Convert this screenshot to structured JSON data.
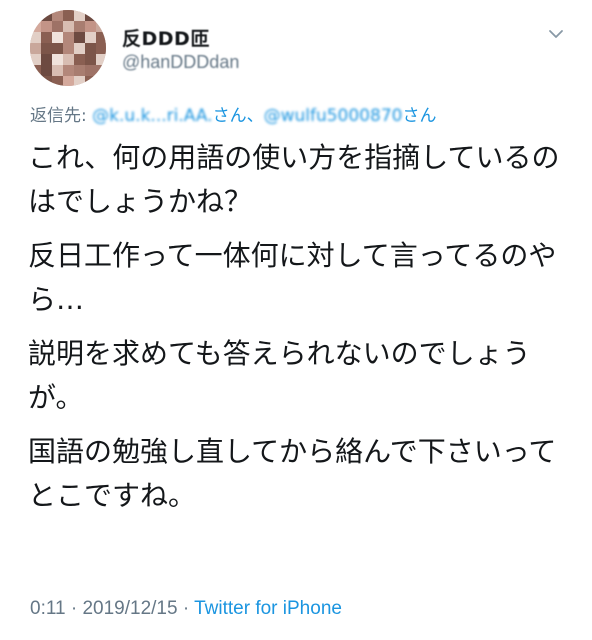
{
  "author": {
    "display_name": "反DDD匝",
    "handle": "@hanDDDdan",
    "avatar_icon": "pixelated-avatar-icon"
  },
  "menu_icon": "chevron-down-icon",
  "reply": {
    "prefix": "返信先: ",
    "mention_1": "@k.u.k...ri.AA.",
    "suffix_1": "さん、",
    "mention_2": "@wulfu5000870",
    "suffix_2": "さん"
  },
  "tweet": {
    "paragraphs": [
      "これ、何の用語の使い方を指摘しているのはでしょうかね？",
      "反日工作って一体何に対して言ってるのやら…",
      "説明を求めても答えられないのでしょうが。",
      "国語の勉強し直してから絡んで下さいってとこですね。"
    ]
  },
  "meta": {
    "time": "0:11",
    "separator": " · ",
    "date": "2019/12/15",
    "source_prefix": " · ",
    "source": "Twitter for iPhone"
  },
  "colors": {
    "link": "#1b95e0",
    "secondary": "#657786",
    "text": "#14171a"
  }
}
